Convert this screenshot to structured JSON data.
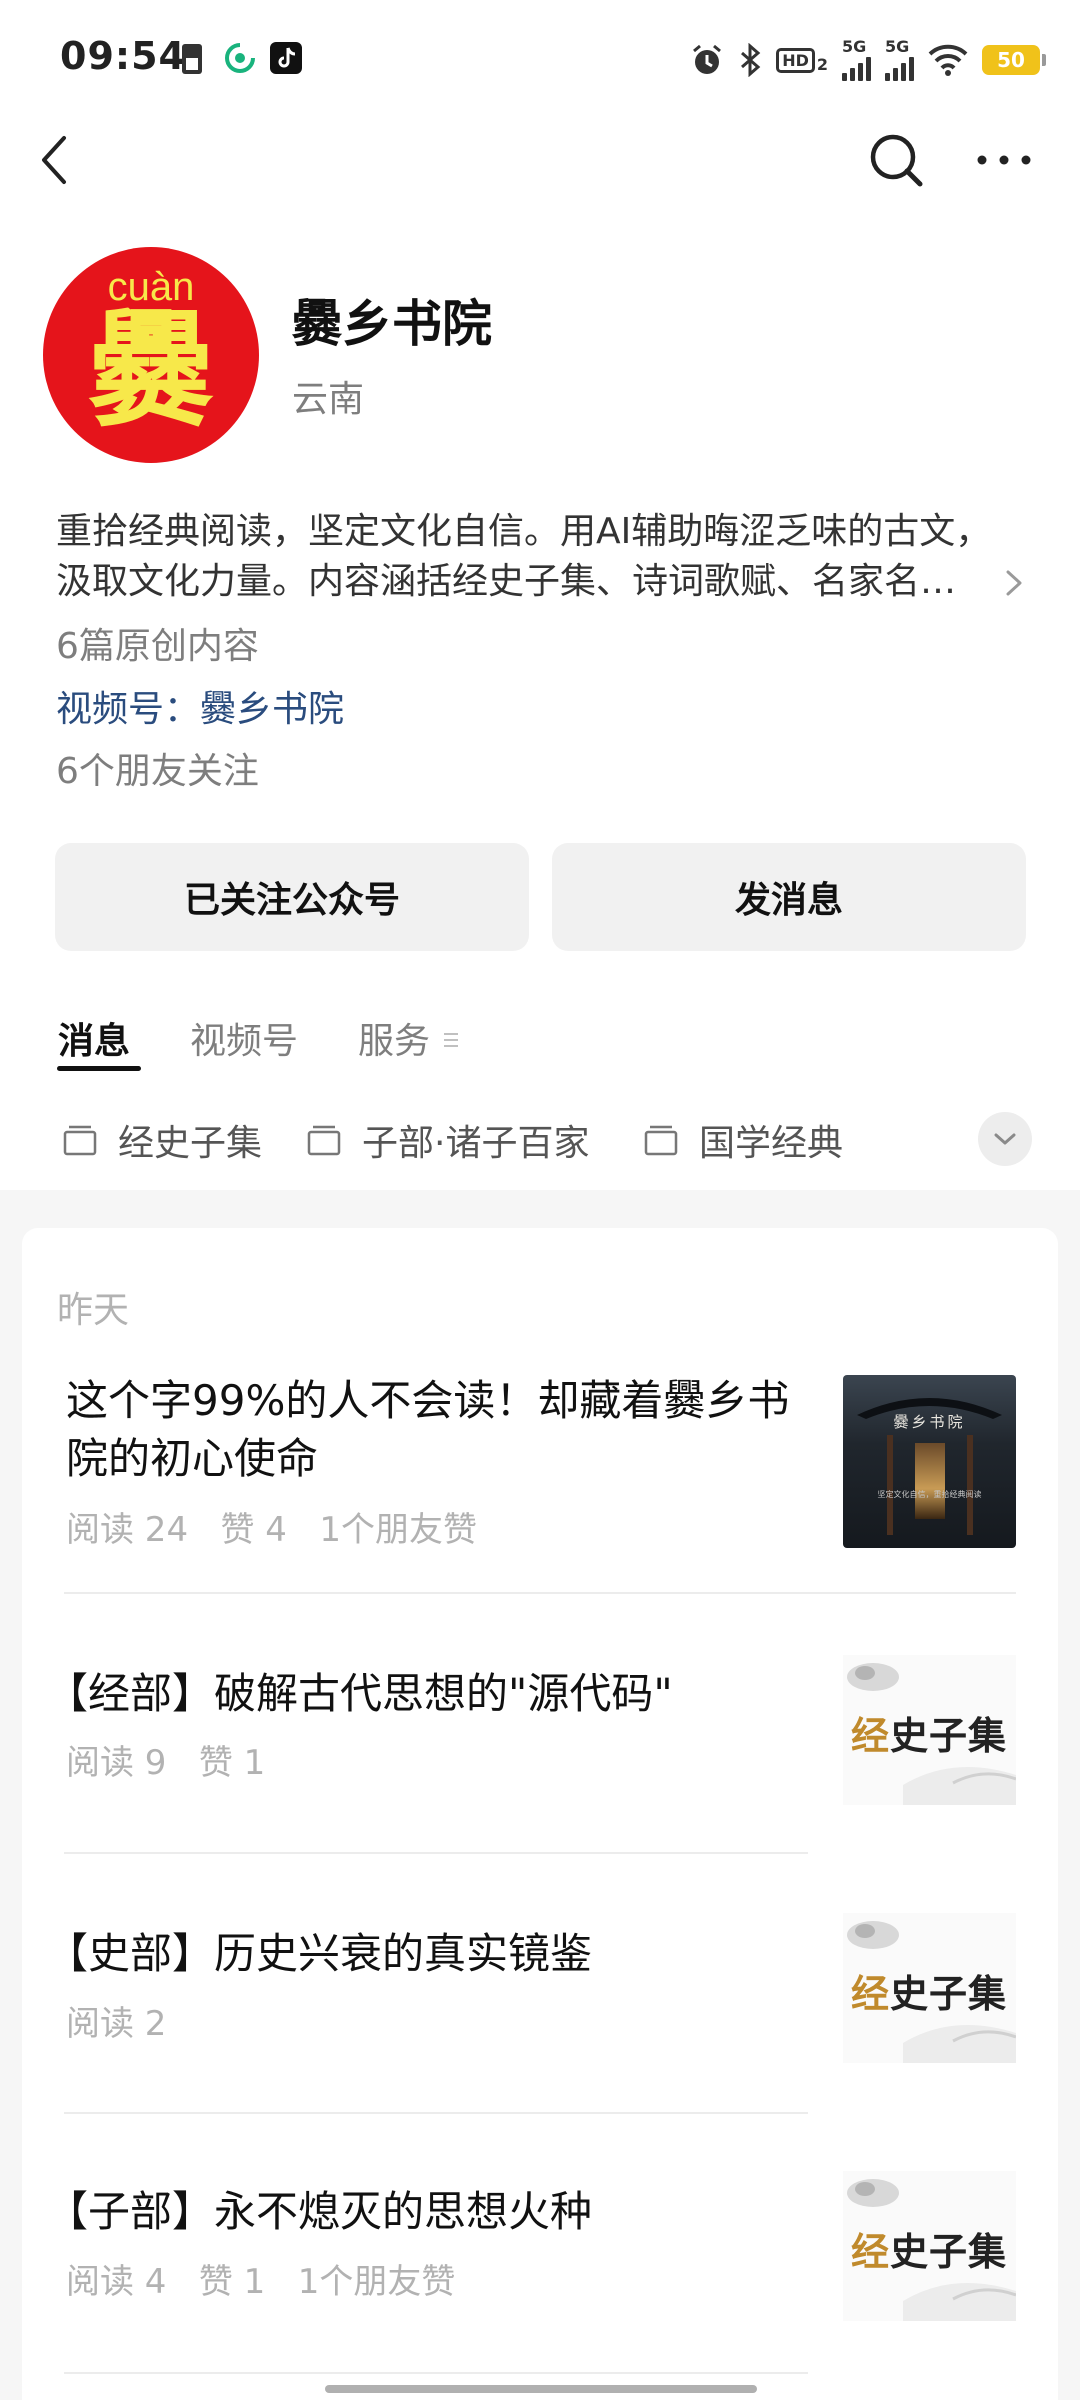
{
  "status_bar": {
    "time": "09:54",
    "network_1": "5G",
    "network_2": "5G",
    "hd_label": "HD",
    "hd_sub": "2",
    "battery": "50"
  },
  "profile": {
    "avatar_pinyin": "cuàn",
    "avatar_char": "爨",
    "name": "爨乡书院",
    "location": "云南",
    "intro_line1": "重拾经典阅读，坚定文化自信。用AI辅助晦涩乏味的古文，",
    "intro_line2": "汲取文化力量。内容涵括经史子集、诗词歌赋、名家名…",
    "original_count": "6篇原创内容",
    "channel_link": "视频号：爨乡书院",
    "friends_follow": "6个朋友关注"
  },
  "actions": {
    "follow_label": "已关注公众号",
    "message_label": "发消息"
  },
  "tabs": [
    {
      "label": "消息"
    },
    {
      "label": "视频号"
    },
    {
      "label": "服务"
    }
  ],
  "collections": [
    {
      "label": "经史子集"
    },
    {
      "label": "子部·诸子百家"
    },
    {
      "label": "国学经典"
    }
  ],
  "feed": {
    "date_label": "昨天",
    "articles": [
      {
        "title": "这个字99%的人不会读！却藏着爨乡书院的初心使命",
        "meta": "阅读 24   赞 4   1个朋友赞",
        "thumb_title": "爨乡书院",
        "thumb_sub": "坚定文化自信，重拾经典阅读"
      },
      {
        "title": "【经部】破解古代思想的\"源代码\"",
        "meta": "阅读 9   赞 1",
        "thumb_text_first": "经",
        "thumb_text_rest": "史子集"
      },
      {
        "title": "【史部】历史兴衰的真实镜鉴",
        "meta": "阅读 2",
        "thumb_text_first": "经",
        "thumb_text_rest": "史子集"
      },
      {
        "title": "【子部】永不熄灭的思想火种",
        "meta": "阅读 4   赞 1   1个朋友赞",
        "thumb_text_first": "经",
        "thumb_text_rest": "史子集"
      }
    ]
  },
  "colors": {
    "accent_link": "#2a4c7e",
    "avatar_bg": "#e5141b",
    "avatar_fg": "#f7e84a",
    "battery": "#f0c21a",
    "button_bg": "#f1f1f1"
  }
}
